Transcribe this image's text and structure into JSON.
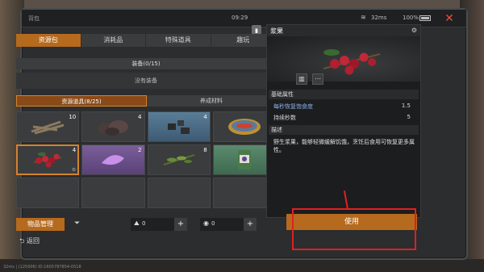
{
  "topbar": {
    "title": "背包",
    "time": "09:29",
    "ping": "32ms",
    "battery": "100%",
    "close": "✕"
  },
  "tabs": [
    "资源包",
    "消耗品",
    "特殊道具",
    "趣玩"
  ],
  "equip": {
    "label": "装备(0/15)",
    "empty": "没有装备",
    "info": "i"
  },
  "subtabs": [
    "资源道具(8/25)",
    "养成材料"
  ],
  "items": [
    {
      "name": "branches",
      "count": "10",
      "color": "gray"
    },
    {
      "name": "ore",
      "count": "4",
      "color": "gray"
    },
    {
      "name": "stones",
      "count": "4",
      "color": "blue"
    },
    {
      "name": "canned-fish",
      "count": "",
      "color": "gray"
    },
    {
      "name": "berries",
      "count": "4",
      "color": "gray"
    },
    {
      "name": "purple-petal",
      "count": "2",
      "color": "purple"
    },
    {
      "name": "herb",
      "count": "8",
      "color": "gray"
    },
    {
      "name": "canned-food",
      "count": "",
      "color": "green"
    }
  ],
  "bottom": {
    "manage": "物品管理",
    "res1": "0",
    "res2": "0",
    "plus": "+",
    "back": "返回"
  },
  "detail": {
    "title": "浆果",
    "basic": "基础属性",
    "attrs": [
      {
        "k": "每秒恢复饱食度",
        "v": "1.5"
      },
      {
        "k": "持续秒数",
        "v": "5"
      }
    ],
    "desc_title": "描述",
    "desc": "野生浆果，能够轻微缓解饥饿，烹饪后食用可恢复更多属性。",
    "use": "使用"
  },
  "footer": "32ms | (125006) ID:1605787854-0518"
}
